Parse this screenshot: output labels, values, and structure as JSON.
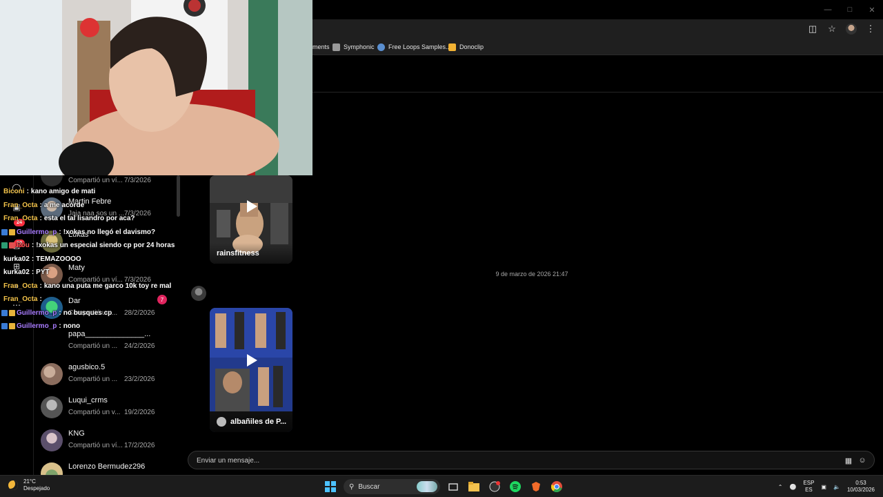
{
  "bookmarks": [
    {
      "label": "ments",
      "color": "#444"
    },
    {
      "label": "Symphonic",
      "color": "#9a9a9a"
    },
    {
      "label": "Free Loops Samples...",
      "color": "#5a8fd0"
    },
    {
      "label": "Donoclip",
      "color": "#f2b233"
    }
  ],
  "nav_badges": {
    "notifications": "24",
    "messages": "99"
  },
  "conversations": [
    {
      "name": "",
      "preview": "Compartió un ví...",
      "date": "7/3/2026"
    },
    {
      "name": "Martin Febre",
      "preview": "Jaja naa sos un ...",
      "date": "7/3/2026"
    },
    {
      "name": "Lukas",
      "preview": "",
      "date": ""
    },
    {
      "name": "Maty",
      "preview": "Compartió un ví...",
      "date": "7/3/2026"
    },
    {
      "name": "Dar",
      "preview": "Compartió un ...",
      "date": "28/2/2026",
      "unread": "7"
    },
    {
      "name": "papa______________...",
      "preview": "Compartió un ...",
      "date": "24/2/2026"
    },
    {
      "name": "agusbico.5",
      "preview": "Compartió un ...",
      "date": "23/2/2026"
    },
    {
      "name": "Luqui_crms",
      "preview": "Compartió un v...",
      "date": "19/2/2026"
    },
    {
      "name": "KNG",
      "preview": "Compartió un ví...",
      "date": "17/2/2026"
    },
    {
      "name": "Lorenzo Bermudez296",
      "preview": "",
      "date": ""
    }
  ],
  "thread": {
    "media_1_caption": "rainsfitness",
    "date_separator": "9 de marzo de 2026 21:47",
    "media_2_caption": "albañiles de P..."
  },
  "composer": {
    "placeholder": "Enviar un mensaje..."
  },
  "chat": [
    {
      "user": "Biconi",
      "color": "#f3c34a",
      "message": "kano amigo de mati",
      "badges": []
    },
    {
      "user": "Fran_Octa",
      "color": "#f3c34a",
      "message": "a me acorde",
      "badges": []
    },
    {
      "user": "Fran_Octa",
      "color": "#f3c34a",
      "message": "esta el tal lisandro por aca?",
      "badges": []
    },
    {
      "user": "Guillermo_p",
      "color": "#a97cff",
      "message": "!xokas no llegó el davismo?",
      "badges": [
        "#3a7bd5",
        "#e8b33a"
      ]
    },
    {
      "user": "Pou",
      "color": "#ff5a5a",
      "message": "!xokas un especial siendo cp por 24 horas",
      "badges": [
        "#2d9c73",
        "#e05050"
      ]
    },
    {
      "user": "kurka02",
      "color": "#ffffff",
      "message": "TEMAZOOOO",
      "badges": []
    },
    {
      "user": "kurka02",
      "color": "#ffffff",
      "message": "PYT",
      "badges": []
    },
    {
      "user": "Fran_Octa",
      "color": "#f3c34a",
      "message": "kano una puta me garco 10k toy re mal",
      "badges": []
    },
    {
      "user": "Fran_Octa",
      "color": "#f3c34a",
      "message": "",
      "badges": []
    },
    {
      "user": "Guillermo_p",
      "color": "#a97cff",
      "message": "no busques cp",
      "badges": [
        "#3a7bd5",
        "#e8b33a"
      ]
    },
    {
      "user": "Guillermo_p",
      "color": "#a97cff",
      "message": "nono",
      "badges": [
        "#3a7bd5",
        "#e8b33a"
      ]
    }
  ],
  "taskbar": {
    "weather_temp": "21°C",
    "weather_desc": "Despejado",
    "search_label": "Buscar",
    "lang_top": "ESP",
    "lang_bottom": "ES",
    "time": "0:53",
    "date": "10/03/2026"
  }
}
